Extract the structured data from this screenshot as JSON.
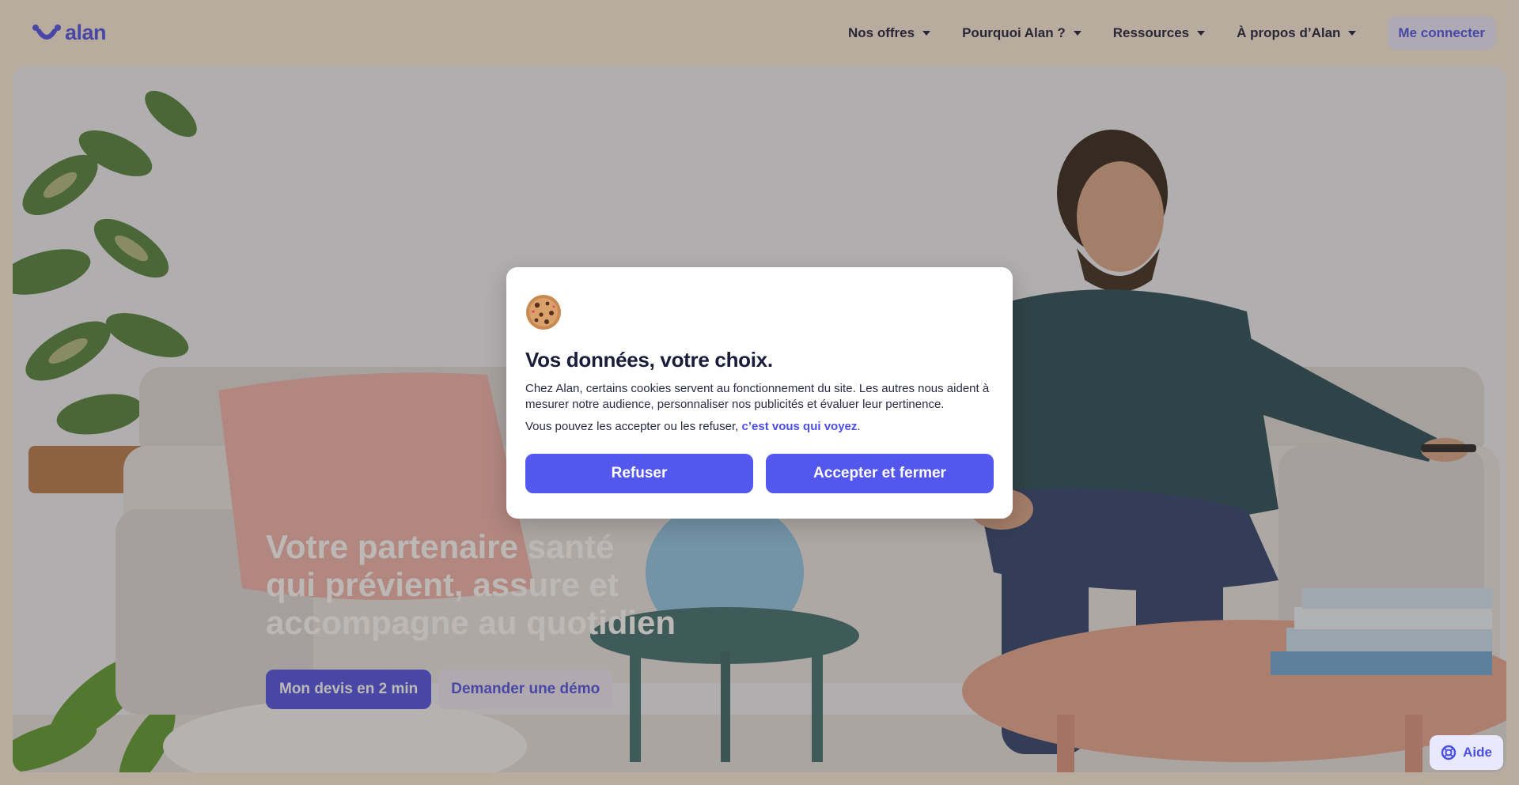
{
  "header": {
    "logo_text": "alan",
    "nav": [
      {
        "label": "Nos offres"
      },
      {
        "label": "Pourquoi Alan ?"
      },
      {
        "label": "Ressources"
      },
      {
        "label": "À propos d’Alan"
      }
    ],
    "login_label": "Me connecter"
  },
  "hero": {
    "title_lines": [
      "Votre partenaire santé",
      "qui prévient, assure et",
      "accompagne au quotidien"
    ],
    "primary_cta": "Mon devis en 2 min",
    "secondary_cta": "Demander une démo"
  },
  "help": {
    "label": "Aide",
    "icon": "lifebuoy-icon"
  },
  "cookie_modal": {
    "icon": "cookie-icon",
    "title": "Vos données, votre choix.",
    "text": "Chez Alan, certains cookies servent au fonctionnement du site. Les autres nous aident à mesurer notre audience, personnaliser nos publicités et évaluer leur pertinence.",
    "text2_prefix": "Vous pouvez les accepter ou les refuser, ",
    "text2_link": "c’est vous qui voyez",
    "text2_suffix": ".",
    "refuse_label": "Refuser",
    "accept_label": "Accepter et fermer"
  },
  "colors": {
    "brand": "#4b4fe8",
    "page_bg": "#f7ecdc",
    "overlay": "rgba(70,58,50,0.36)"
  }
}
